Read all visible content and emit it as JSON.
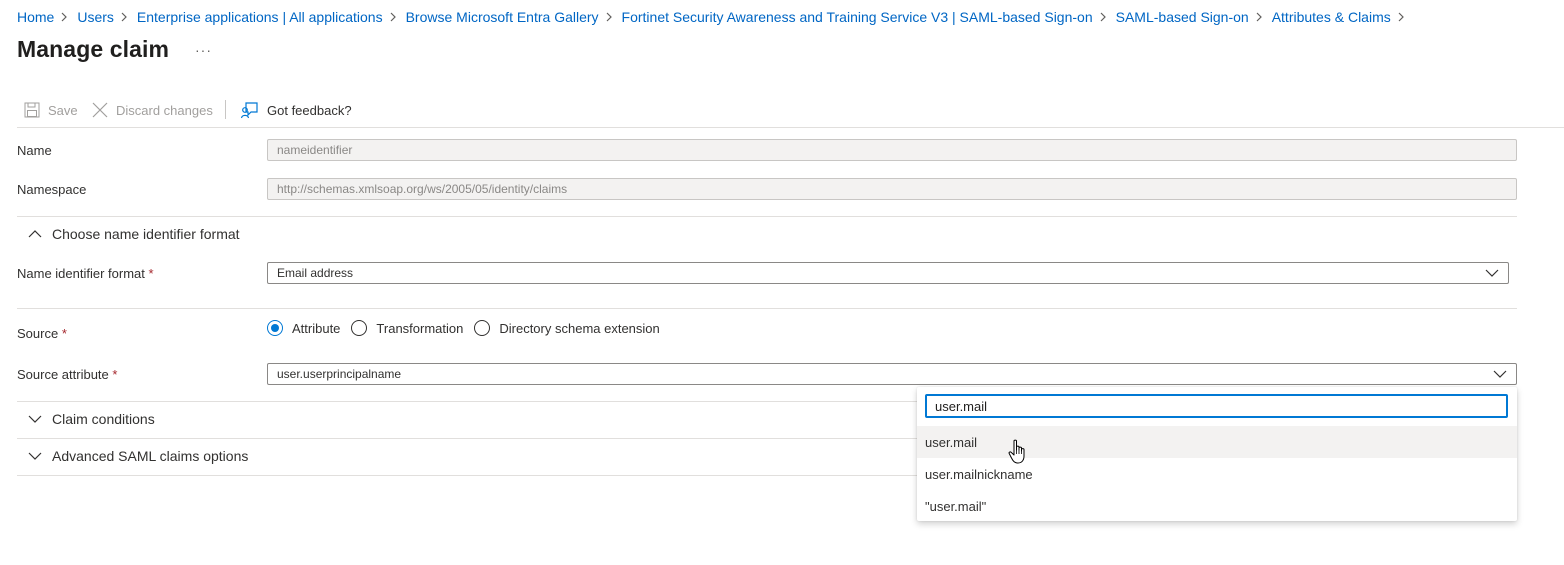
{
  "breadcrumb": [
    {
      "label": "Home"
    },
    {
      "label": "Users"
    },
    {
      "label": "Enterprise applications | All applications"
    },
    {
      "label": "Browse Microsoft Entra Gallery"
    },
    {
      "label": "Fortinet Security Awareness and Training Service V3 | SAML-based Sign-on"
    },
    {
      "label": "SAML-based Sign-on"
    },
    {
      "label": "Attributes & Claims"
    }
  ],
  "page": {
    "title": "Manage claim",
    "more": "···"
  },
  "toolbar": {
    "save_label": "Save",
    "discard_label": "Discard changes",
    "feedback_label": "Got feedback?"
  },
  "form": {
    "name_label": "Name",
    "name_value": "nameidentifier",
    "namespace_label": "Namespace",
    "namespace_value": "http://schemas.xmlsoap.org/ws/2005/05/identity/claims",
    "choose_format_section": "Choose name identifier format",
    "format_label": "Name identifier format",
    "format_value": "Email address",
    "required_mark": "*",
    "source_label": "Source",
    "source_options": [
      "Attribute",
      "Transformation",
      "Directory schema extension"
    ],
    "source_selected": "Attribute",
    "source_attribute_label": "Source attribute",
    "source_attribute_value": "user.userprincipalname",
    "claim_conditions_section": "Claim conditions",
    "advanced_section": "Advanced SAML claims options"
  },
  "dropdown_panel": {
    "search_value": "user.mail",
    "options": [
      "user.mail",
      "user.mailnickname",
      "\"user.mail\""
    ],
    "hovered_option": "user.mail"
  },
  "colors": {
    "link": "#0066c4",
    "accent": "#0078d4",
    "required": "#a4262c"
  }
}
